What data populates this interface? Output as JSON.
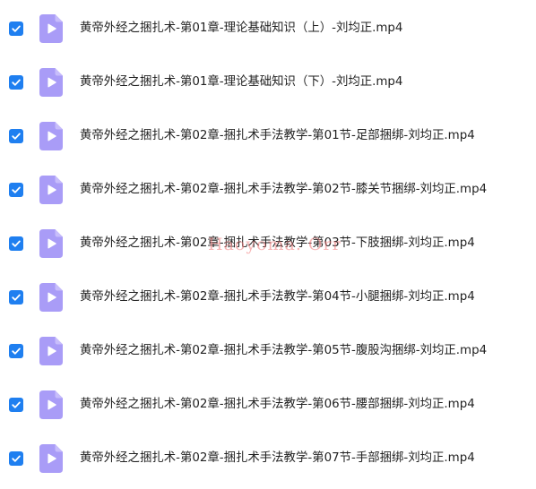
{
  "colors": {
    "checkbox": "#1f7ff0",
    "file_icon": "#a99cf7",
    "row_separator": "#eef0f4",
    "text": "#222222",
    "watermark": "#f07878"
  },
  "icons": {
    "checkbox": "checkmark-icon",
    "file": "video-file-play-icon"
  },
  "files": [
    {
      "name": "黄帝外经之捆扎术-第01章-理论基础知识（上）-刘均正.mp4",
      "checked": true
    },
    {
      "name": "黄帝外经之捆扎术-第01章-理论基础知识（下）-刘均正.mp4",
      "checked": true
    },
    {
      "name": "黄帝外经之捆扎术-第02章-捆扎术手法教学-第01节-足部捆绑-刘均正.mp4",
      "checked": true
    },
    {
      "name": "黄帝外经之捆扎术-第02章-捆扎术手法教学-第02节-膝关节捆绑-刘均正.mp4",
      "checked": true
    },
    {
      "name": "黄帝外经之捆扎术-第02章-捆扎术手法教学-第03节-下肢捆绑-刘均正.mp4",
      "checked": true
    },
    {
      "name": "黄帝外经之捆扎术-第02章-捆扎术手法教学-第04节-小腿捆绑-刘均正.mp4",
      "checked": true
    },
    {
      "name": "黄帝外经之捆扎术-第02章-捆扎术手法教学-第05节-腹股沟捆绑-刘均正.mp4",
      "checked": true
    },
    {
      "name": "黄帝外经之捆扎术-第02章-捆扎术手法教学-第06节-腰部捆绑-刘均正.mp4",
      "checked": true
    },
    {
      "name": "黄帝外经之捆扎术-第02章-捆扎术手法教学-第07节-手部捆绑-刘均正.mp4",
      "checked": true
    }
  ],
  "watermark": {
    "text": "Haoyoma. Orr"
  }
}
